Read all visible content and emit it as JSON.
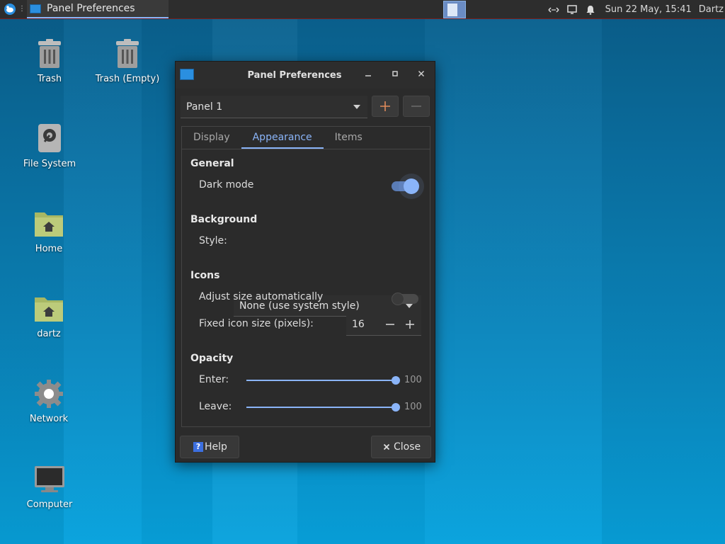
{
  "panel": {
    "task_title": "Panel Preferences",
    "clock": "Sun 22 May, 15:41",
    "user": "Dartz"
  },
  "desktop": {
    "icons": [
      {
        "label": "Trash"
      },
      {
        "label": "Trash (Empty)"
      },
      {
        "label": "File System"
      },
      {
        "label": "Home"
      },
      {
        "label": "dartz"
      },
      {
        "label": "Network"
      },
      {
        "label": "Computer"
      }
    ]
  },
  "dialog": {
    "title": "Panel Preferences",
    "panel_select": "Panel 1",
    "tabs": [
      "Display",
      "Appearance",
      "Items"
    ],
    "active_tab": "Appearance",
    "general": {
      "heading": "General",
      "dark_mode_label": "Dark mode",
      "dark_mode_on": true
    },
    "background": {
      "heading": "Background",
      "style_label": "Style:",
      "style_value": "None (use system style)"
    },
    "icons": {
      "heading": "Icons",
      "adjust_label": "Adjust size automatically",
      "adjust_on": false,
      "fixed_label": "Fixed icon size (pixels):",
      "fixed_value": "16"
    },
    "opacity": {
      "heading": "Opacity",
      "enter_label": "Enter:",
      "enter_value": "100",
      "leave_label": "Leave:",
      "leave_value": "100"
    },
    "help_label": "Help",
    "close_label": "Close"
  },
  "colors": {
    "accent": "#8ab4f8",
    "dialog_bg": "#2b2b2b"
  }
}
